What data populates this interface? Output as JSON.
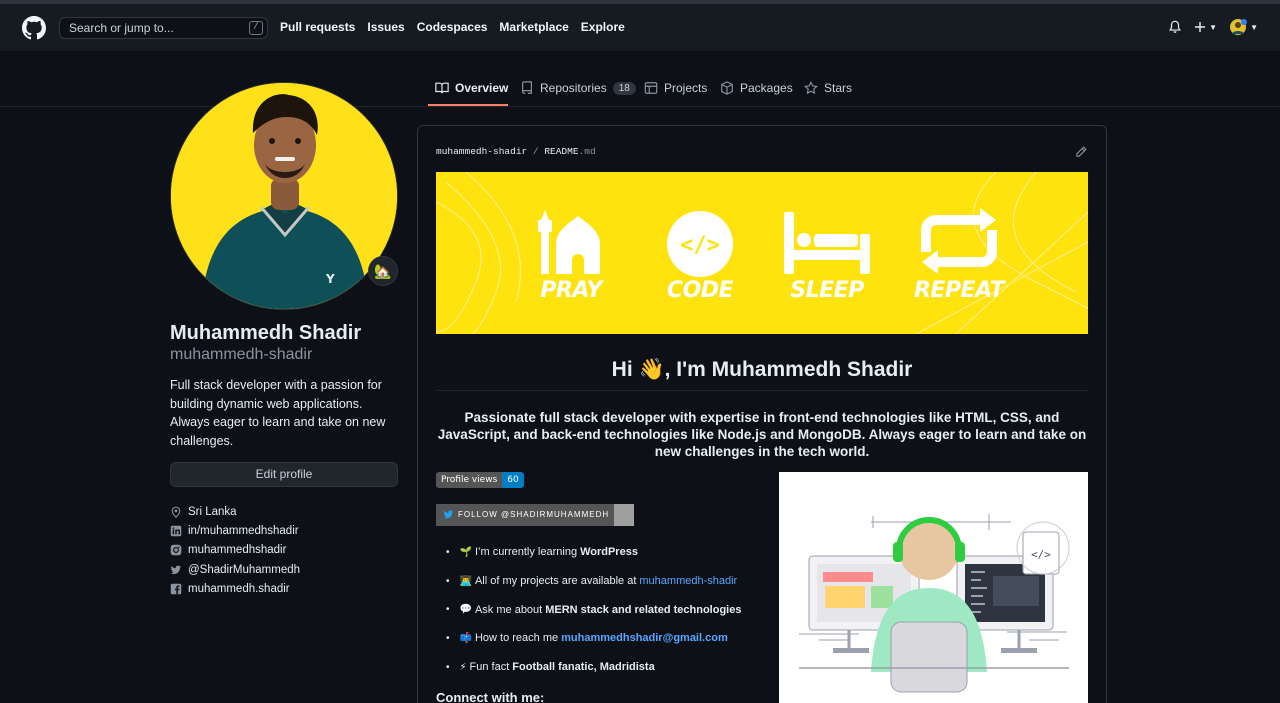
{
  "header": {
    "search_placeholder": "Search or jump to...",
    "search_key": "/",
    "nav": [
      "Pull requests",
      "Issues",
      "Codespaces",
      "Marketplace",
      "Explore"
    ]
  },
  "tabs": {
    "overview": "Overview",
    "repositories": "Repositories",
    "repositories_count": "18",
    "projects": "Projects",
    "packages": "Packages",
    "stars": "Stars"
  },
  "profile": {
    "status_emoji": "🏡",
    "name": "Muhammedh Shadir",
    "login": "muhammedh-shadir",
    "bio": "Full stack developer with a passion for building dynamic web applications. Always eager to learn and take on new challenges.",
    "edit_label": "Edit profile",
    "location": "Sri Lanka",
    "linkedin": "in/muhammedhshadir",
    "instagram": "muhammedhshadir",
    "twitter": "@ShadirMuhammedh",
    "facebook": "muhammedh.shadir"
  },
  "readme": {
    "crumb_user": "muhammedh-shadir",
    "crumb_sep": "/",
    "crumb_file": "README",
    "crumb_ext": ".md",
    "banner": [
      "PRAY",
      "CODE",
      "SLEEP",
      "REPEAT"
    ],
    "greeting": "Hi 👋, I'm Muhammedh Shadir",
    "tagline": "Passionate full stack developer with expertise in front-end technologies like HTML, CSS, and JavaScript, and back-end technologies like Node.js and MongoDB. Always eager to learn and take on new challenges in the tech world.",
    "views_label": "Profile views",
    "views_count": "60",
    "follow_label": "FOLLOW @SHADIRMUHAMMEDH",
    "items": [
      {
        "emoji": "🌱",
        "text": "I’m currently learning",
        "bold": "WordPress"
      },
      {
        "emoji": "👨‍💻",
        "text": "All of my projects are available at",
        "link": "muhammedh-shadir"
      },
      {
        "emoji": "💬",
        "text": "Ask me about",
        "bold": "MERN stack and related technologies"
      },
      {
        "emoji": "📫",
        "text": "How to reach me",
        "link": "muhammedhshadir@gmail.com"
      },
      {
        "emoji": "⚡",
        "text": "Fun fact",
        "bold": "Football fanatic, Madridista"
      }
    ],
    "connect": "Connect with me:"
  },
  "colors": {
    "bg": "#0d1117",
    "header": "#161b22",
    "accent_tab": "#f78166",
    "link": "#58a6ff",
    "banner": "#ffe30f"
  }
}
